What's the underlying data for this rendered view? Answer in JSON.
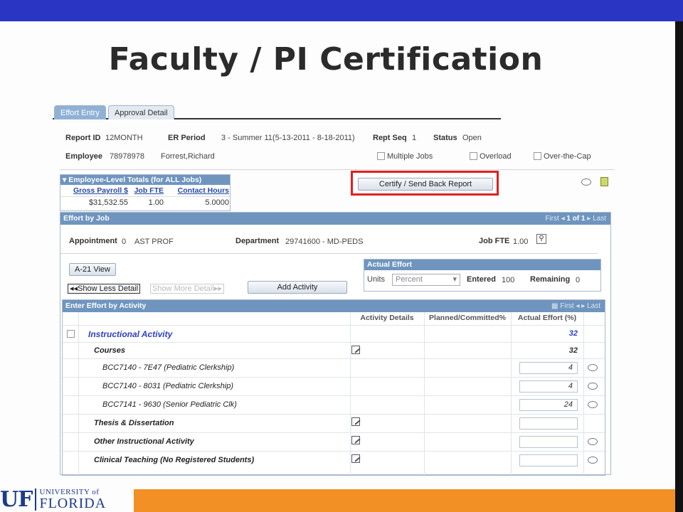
{
  "slide": {
    "title": "Faculty / PI Certification",
    "logo": {
      "mark": "UF",
      "line1": "UNIVERSITY of",
      "line2": "FLORIDA"
    }
  },
  "tabs": [
    {
      "label": "Effort Entry",
      "active": true
    },
    {
      "label": "Approval Detail",
      "active": false
    }
  ],
  "report": {
    "report_id_label": "Report ID",
    "report_id": "12MONTH",
    "er_period_label": "ER Period",
    "er_period": "3 - Summer 11(5-13-2011 - 8-18-2011)",
    "rept_seq_label": "Rept Seq",
    "rept_seq": "1",
    "status_label": "Status",
    "status": "Open",
    "employee_label": "Employee",
    "employee_id": "78978978",
    "employee_name": "Forrest,Richard",
    "multiple_jobs": "Multiple Jobs",
    "overload": "Overload",
    "over_cap": "Over-the-Cap"
  },
  "totals": {
    "title": "Employee-Level Totals (for ALL Jobs)",
    "columns": [
      "Gross Payroll $",
      "Job FTE",
      "Contact Hours"
    ],
    "values": [
      "$31,532.55",
      "1.00",
      "5.0000"
    ]
  },
  "certify_button": "Certify / Send Back Report",
  "effort_by_job": {
    "title": "Effort by Job",
    "nav": {
      "first": "First",
      "range": "1 of 1",
      "last": "Last"
    },
    "appointment_label": "Appointment",
    "appointment_num": "0",
    "appointment_title": "AST PROF",
    "department_label": "Department",
    "department": "29741600 - MD-PEDS",
    "job_fte_label": "Job FTE",
    "job_fte": "1.00",
    "a21_view": "A-21 View",
    "show_less": "Show Less Detail",
    "show_more": "Show More Detail",
    "add_activity": "Add Activity"
  },
  "actual_effort": {
    "title": "Actual Effort",
    "units_label": "Units",
    "units_value": "Percent",
    "entered_label": "Entered",
    "entered": "100",
    "remaining_label": "Remaining",
    "remaining": "0"
  },
  "activity_grid": {
    "title": "Enter Effort by Activity",
    "nav": {
      "first": "First",
      "last": "Last"
    },
    "columns": [
      "Activity Details",
      "Planned/Committed%",
      "Actual Effort (%)"
    ],
    "rows": [
      {
        "name": "Instructional Activity",
        "actual": "32"
      },
      {
        "name": "Courses",
        "actual": "32"
      },
      {
        "name": "BCC7140 - 7E47 (Pediatric Clerkship)",
        "actual": "4"
      },
      {
        "name": "BCC7140 - 8031 (Pediatric Clerkship)",
        "actual": "4"
      },
      {
        "name": "BCC7141 - 9630 (Senior Pediatric Clk)",
        "actual": "24"
      },
      {
        "name": "Thesis & Dissertation",
        "actual": ""
      },
      {
        "name": "Other Instructional Activity",
        "actual": ""
      },
      {
        "name": "Clinical Teaching (No Registered Students)",
        "actual": ""
      }
    ]
  },
  "colors": {
    "top_bar": "#2a35c4",
    "bottom_bar": "#f39025",
    "highlight": "#e41e1e",
    "section_header": "#6f95bf"
  }
}
